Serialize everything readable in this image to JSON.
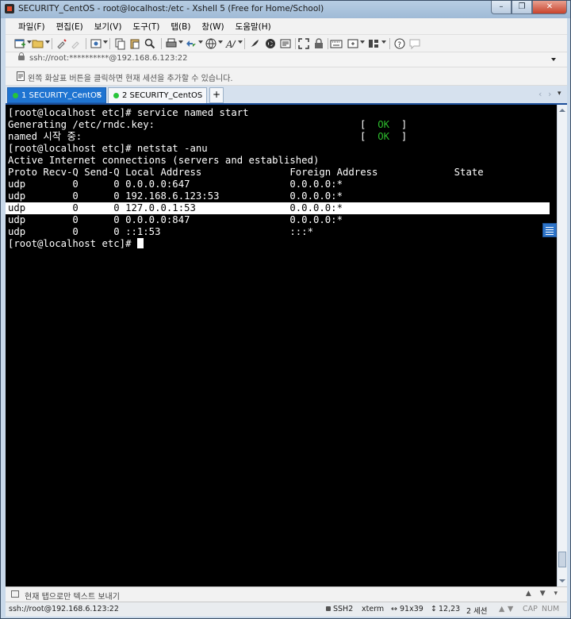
{
  "window": {
    "title": "SECURITY_CentOS - root@localhost:/etc - Xshell 5 (Free for Home/School)",
    "controls": [
      "–",
      "❐",
      "✕"
    ]
  },
  "menu": [
    "파일(F)",
    "편집(E)",
    "보기(V)",
    "도구(T)",
    "탭(B)",
    "창(W)",
    "도움말(H)"
  ],
  "address": {
    "text": "ssh://root:**********@192.168.6.123:22"
  },
  "hint": {
    "text": "왼쪽 화살표 버튼을 클릭하면 현재 세션을 추가할 수 있습니다."
  },
  "tabs": [
    {
      "label": "1 SECURITY_CentOS",
      "close": "×"
    },
    {
      "label": "2 SECURITY_CentOS",
      "close": "×"
    }
  ],
  "tab_add": "+",
  "tab_nav": [
    "‹",
    "›",
    "▾"
  ],
  "terminal": {
    "lines": [
      "[root@localhost etc]# service named start",
      "Generating /etc/rndc.key:",
      "named 시작 중:",
      "[root@localhost etc]# netstat -anu",
      "Active Internet connections (servers and established)",
      "Proto Recv-Q Send-Q Local Address               Foreign Address             State",
      "udp        0      0 0.0.0.0:647                 0.0.0.0:*",
      "udp        0      0 192.168.6.123:53            0.0.0.0:*",
      "udp        0      0 127.0.0.1:53                0.0.0.0:*",
      "udp        0      0 0.0.0.0:847                 0.0.0.0:*",
      "udp        0      0 ::1:53                      :::*",
      "[root@localhost etc]# "
    ],
    "ok_open": "[  ",
    "ok_text": "OK",
    "ok_close": "  ]"
  },
  "compose": {
    "text": "현재 탭으로만 텍스트 보내기"
  },
  "status": {
    "connection": "ssh://root@192.168.6.123:22",
    "protocol": "SSH2",
    "terminal_type": "xterm",
    "size": "91x39",
    "cursor_pos": "12,23",
    "sessions": "2 세션",
    "caps": "CAP",
    "num": "NUM"
  }
}
